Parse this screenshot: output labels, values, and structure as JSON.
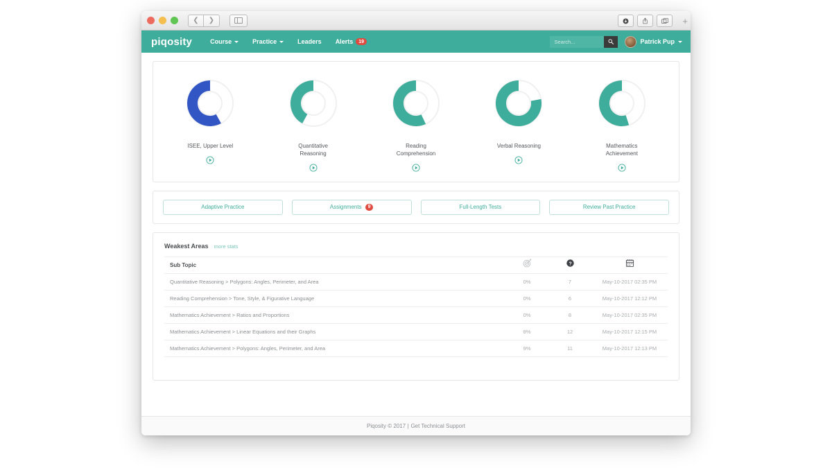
{
  "browser": {
    "back_icon": "chevron-left-icon",
    "forward_icon": "chevron-right-icon",
    "sidebar_icon": "sidebar-toggle-icon",
    "download_icon": "download-icon",
    "share_icon": "share-icon",
    "tabs_icon": "tab-overview-icon",
    "new_tab_label": "+"
  },
  "navbar": {
    "brand": "piqosity",
    "links": [
      {
        "label": "Course",
        "caret": true
      },
      {
        "label": "Practice",
        "caret": true
      },
      {
        "label": "Leaders",
        "caret": false
      },
      {
        "label": "Alerts",
        "caret": false,
        "badge": "19"
      }
    ],
    "search": {
      "placeholder": "Search...",
      "value": "",
      "icon": "search-icon"
    },
    "user": {
      "name": "Patrick Pup",
      "caret": true,
      "avatar": "user-avatar"
    }
  },
  "colors": {
    "brand_teal": "#3fad9b",
    "accent_blue": "#3257c4",
    "badge_red": "#e04a3f",
    "track_gray": "#f0f0f0"
  },
  "chart_data": [
    {
      "type": "pie",
      "title": "ISEE, Upper Level",
      "label_lines": [
        "ISEE, Upper Level"
      ],
      "value_percent": 58,
      "color": "#3257c4",
      "track_color": "#f0f0f0",
      "direction": "counterclockwise",
      "start_angle_deg": 90
    },
    {
      "type": "pie",
      "title": "Quantitative Reasoning",
      "label_lines": [
        "Quantitative",
        "Reasoning"
      ],
      "value_percent": 42,
      "color": "#3fad9b",
      "track_color": "#f0f0f0",
      "direction": "counterclockwise",
      "start_angle_deg": 90
    },
    {
      "type": "pie",
      "title": "Reading Comprehension",
      "label_lines": [
        "Reading",
        "Comprehension"
      ],
      "value_percent": 57,
      "color": "#3fad9b",
      "track_color": "#f0f0f0",
      "direction": "counterclockwise",
      "start_angle_deg": 90
    },
    {
      "type": "pie",
      "title": "Verbal Reasoning",
      "label_lines": [
        "Verbal Reasoning"
      ],
      "value_percent": 78,
      "color": "#3fad9b",
      "track_color": "#f0f0f0",
      "direction": "counterclockwise",
      "start_angle_deg": 90
    },
    {
      "type": "pie",
      "title": "Mathematics Achievement",
      "label_lines": [
        "Mathematics",
        "Achievement"
      ],
      "value_percent": 55,
      "color": "#3fad9b",
      "track_color": "#f0f0f0",
      "direction": "counterclockwise",
      "start_angle_deg": 90
    }
  ],
  "donut_play_icon": "play-circle-icon",
  "action_buttons": [
    {
      "label": "Adaptive Practice",
      "badge": null
    },
    {
      "label": "Assignments",
      "badge": "9"
    },
    {
      "label": "Full-Length Tests",
      "badge": null
    },
    {
      "label": "Review Past Practice",
      "badge": null
    }
  ],
  "weakest_areas": {
    "title": "Weakest Areas",
    "more_link": "more stats",
    "columns": {
      "sub_topic": "Sub Topic",
      "accuracy_icon": "bullseye-icon",
      "questions_icon": "question-circle-icon",
      "date_icon": "calendar-icon"
    },
    "rows": [
      {
        "sub_topic": "Quantitative Reasoning > Polygons: Angles, Perimeter, and Area",
        "accuracy": "0%",
        "questions": "7",
        "date": "May-10-2017 02:35 PM"
      },
      {
        "sub_topic": "Reading Comprehension > Tone, Style, & Figurative Language",
        "accuracy": "0%",
        "questions": "6",
        "date": "May-10-2017 12:12 PM"
      },
      {
        "sub_topic": "Mathematics Achievement > Ratios and Proportions",
        "accuracy": "0%",
        "questions": "8",
        "date": "May-10-2017 02:35 PM"
      },
      {
        "sub_topic": "Mathematics Achievement > Linear Equations and their Graphs",
        "accuracy": "8%",
        "questions": "12",
        "date": "May-10-2017 12:15 PM"
      },
      {
        "sub_topic": "Mathematics Achievement > Polygons: Angles, Perimeter, and Area",
        "accuracy": "9%",
        "questions": "11",
        "date": "May-10-2017 12:13 PM"
      }
    ]
  },
  "footer": {
    "copyright": "Piqosity © 2017 |",
    "support_link": "Get Technical Support"
  }
}
